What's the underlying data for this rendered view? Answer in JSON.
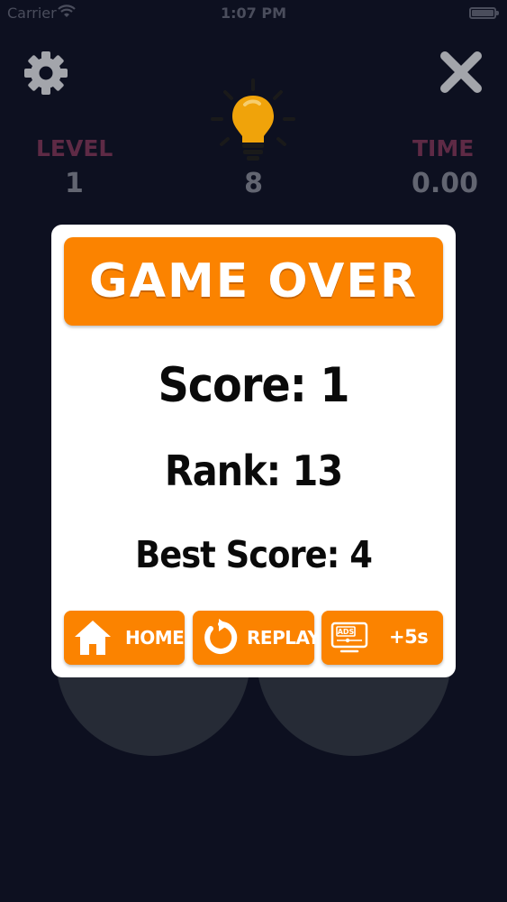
{
  "status_bar": {
    "carrier": "Carrier",
    "time": "1:07 PM"
  },
  "hud": {
    "level_label": "LEVEL",
    "level_value": "1",
    "hints_value": "8",
    "time_label": "TIME",
    "time_value": "0.00"
  },
  "modal": {
    "title": "GAME OVER",
    "score": "Score: 1",
    "rank": "Rank: 13",
    "best_score": "Best Score: 4",
    "buttons": {
      "home": "HOME",
      "replay": "REPLAY",
      "ads_icon_text": "ADS",
      "ads_bonus": "+5s"
    }
  },
  "icons": [
    "settings-gear-icon",
    "close-icon",
    "lightbulb-icon",
    "home-icon",
    "replay-icon",
    "ads-tv-icon",
    "wifi-icon",
    "battery-icon"
  ],
  "colors": {
    "background": "#0d1020",
    "accent_orange": "#fb8300",
    "label_maroon": "#5e2a45",
    "value_gray": "#626571",
    "circle": "#262b36",
    "bulb": "#f0a30a"
  }
}
